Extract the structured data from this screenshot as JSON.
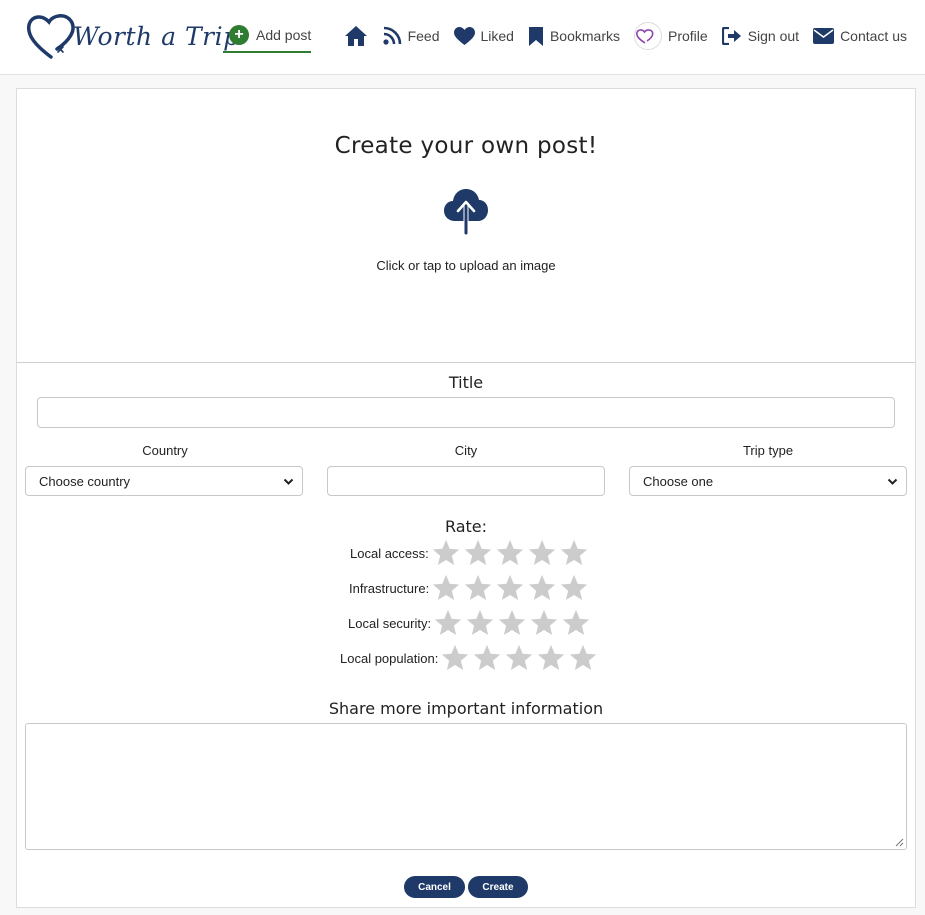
{
  "brand": {
    "name": "Worth a Trip"
  },
  "nav": {
    "add_post": "Add post",
    "feed": "Feed",
    "liked": "Liked",
    "bookmarks": "Bookmarks",
    "profile": "Profile",
    "sign_out": "Sign out",
    "contact": "Contact us"
  },
  "colors": {
    "primary": "#1f3a68",
    "accent_green": "#2e7d32",
    "star_empty": "#cccccc"
  },
  "upload": {
    "heading": "Create your own post!",
    "icon": "cloud-upload-icon",
    "hint": "Click or tap to upload an image"
  },
  "form": {
    "title_label": "Title",
    "title_value": "",
    "country_label": "Country",
    "country_selected": "Choose country",
    "city_label": "City",
    "city_value": "",
    "trip_type_label": "Trip type",
    "trip_type_selected": "Choose one",
    "rate_heading": "Rate:",
    "ratings": [
      {
        "label": "Local access:",
        "value": 0,
        "max": 5
      },
      {
        "label": "Infrastructure:",
        "value": 0,
        "max": 5
      },
      {
        "label": "Local security:",
        "value": 0,
        "max": 5
      },
      {
        "label": "Local population:",
        "value": 0,
        "max": 5
      }
    ],
    "info_heading": "Share more important information",
    "info_value": "",
    "cancel_label": "Cancel",
    "create_label": "Create"
  }
}
